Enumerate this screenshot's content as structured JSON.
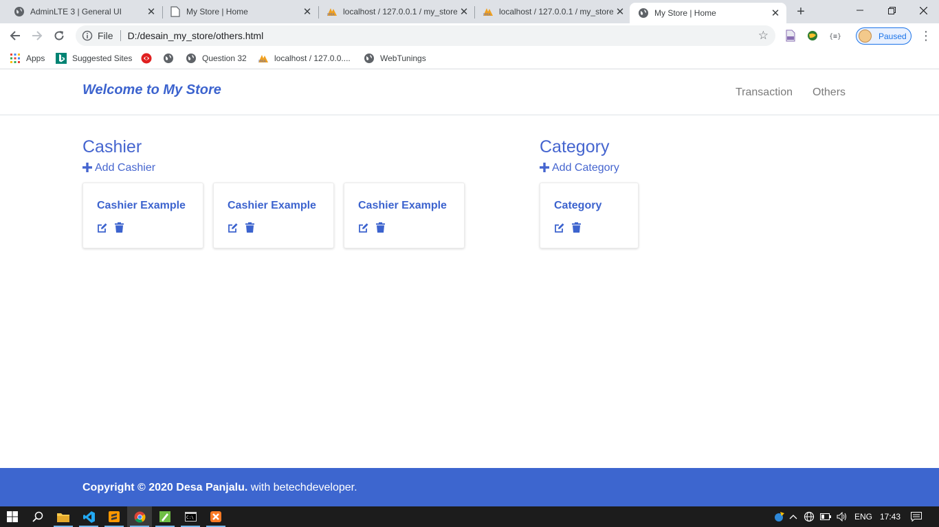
{
  "browser": {
    "tabs": [
      {
        "title": "AdminLTE 3 | General UI",
        "icon": "globe-icon",
        "active": false
      },
      {
        "title": "My Store | Home",
        "icon": "page-icon",
        "active": false
      },
      {
        "title": "localhost / 127.0.0.1 / my_store",
        "icon": "phpmyadmin-icon",
        "active": false
      },
      {
        "title": "localhost / 127.0.0.1 / my_store",
        "icon": "phpmyadmin-icon",
        "active": false
      },
      {
        "title": "My Store | Home",
        "icon": "globe-icon",
        "active": true
      }
    ],
    "address": {
      "scheme_label": "File",
      "url": "D:/desain_my_store/others.html"
    },
    "profile_status": "Paused",
    "bookmarks": [
      {
        "label": "Apps",
        "icon": "apps-grid-icon"
      },
      {
        "label": "Suggested Sites",
        "icon": "bing-icon"
      },
      {
        "label": "",
        "icon": "red-badge-icon"
      },
      {
        "label": "",
        "icon": "globe-icon"
      },
      {
        "label": "Question 32",
        "icon": "globe-icon"
      },
      {
        "label": "localhost / 127.0.0....",
        "icon": "phpmyadmin-icon"
      },
      {
        "label": "WebTunings",
        "icon": "globe-icon"
      }
    ]
  },
  "page": {
    "brand": "Welcome to My Store",
    "nav": [
      "Transaction",
      "Others"
    ],
    "cashier": {
      "title": "Cashier",
      "add_label": "Add Cashier",
      "cards": [
        "Cashier Example",
        "Cashier Example",
        "Cashier Example"
      ]
    },
    "category": {
      "title": "Category",
      "add_label": "Add Category",
      "cards": [
        "Category"
      ]
    },
    "footer": {
      "copyright": "Copyright © 2020 Desa Panjalu.",
      "suffix": "with betechdeveloper."
    },
    "accent_color": "#3d66cf"
  },
  "taskbar": {
    "apps": [
      "windows-start-icon",
      "search-icon",
      "file-explorer-icon",
      "vscode-icon",
      "sublime-text-icon",
      "chrome-icon",
      "notepadqq-icon",
      "cmd-icon",
      "xampp-icon"
    ],
    "language": "ENG",
    "time": "17:43"
  }
}
